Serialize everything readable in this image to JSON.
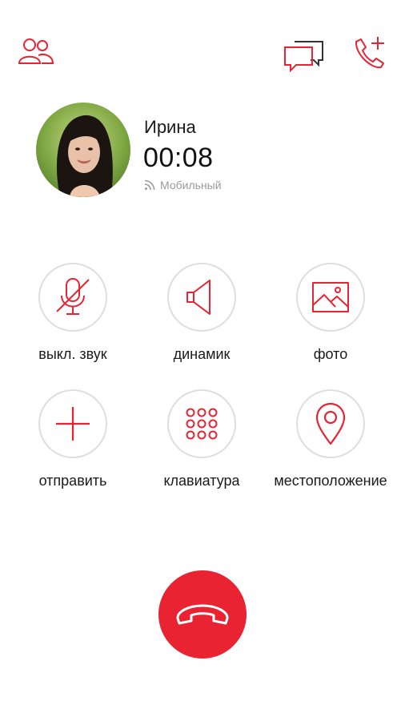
{
  "header": {
    "contacts_icon": "contacts-icon",
    "chat_icon": "chat-icon",
    "add_call_icon": "add-call-icon"
  },
  "caller": {
    "name": "Ирина",
    "duration": "00:08",
    "network": "Мобильный",
    "network_icon": "signal-icon"
  },
  "actions": {
    "mute": {
      "label": "выкл. звук",
      "icon": "mute-mic-icon"
    },
    "speaker": {
      "label": "динамик",
      "icon": "speaker-icon"
    },
    "photo": {
      "label": "фото",
      "icon": "image-icon"
    },
    "send": {
      "label": "отправить",
      "icon": "plus-icon"
    },
    "keypad": {
      "label": "клавиатура",
      "icon": "keypad-icon"
    },
    "location": {
      "label": "местоположение",
      "icon": "location-pin-icon"
    }
  },
  "hangup": {
    "icon": "hangup-icon"
  },
  "colors": {
    "accent": "#ea2332",
    "circle_border": "#dedede",
    "secondary_text": "#9a9a9a"
  }
}
